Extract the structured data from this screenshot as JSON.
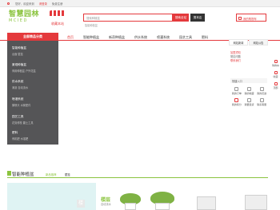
{
  "topbar": {
    "items": [
      "您好，欢迎来到",
      "请登录",
      "免费注册"
    ]
  },
  "header": {
    "logo_cn": "智慧园林",
    "logo_en": "MCIED",
    "badge_caption": "收藏本站",
    "search_placeholder": "搜索种植盆",
    "btn_search_site": "搜索全站",
    "btn_search_shop": "搜本店",
    "hot_words": "智能种植盆",
    "cart_label": "我的购物车"
  },
  "nav": {
    "category_header": "全部商品分类",
    "items": [
      "首页",
      "智能种植盆",
      "新奇种植盆",
      "供水系统",
      "喷灌系统",
      "园艺工具",
      "肥料"
    ]
  },
  "categories": [
    {
      "title": "智能种植盆",
      "sub": "台面  壁挂"
    },
    {
      "title": "景观种植盆",
      "sub": "商用种植盆  户外花盆"
    },
    {
      "title": "供水系统",
      "sub": "滴灌  自动浇水"
    },
    {
      "title": "喷灌系统",
      "sub": "微喷头  水管配件"
    },
    {
      "title": "园艺工具",
      "sub": "花剪修枝  翻土工具"
    },
    {
      "title": "肥料",
      "sub": "有机肥  水溶肥"
    }
  ],
  "user_panel": {
    "tabs": [
      "网站新闻",
      "网站公告"
    ],
    "links": [
      "加盟须知",
      "常见问题",
      "联系我们"
    ],
    "section_label": "快捷入口",
    "icons": [
      {
        "label": "我的订单",
        "icon": "order-icon"
      },
      {
        "label": "我的收藏",
        "icon": "heart-icon"
      },
      {
        "label": "我的足迹",
        "icon": "footprint-icon"
      },
      {
        "label": "我的积分",
        "icon": "points-icon"
      },
      {
        "label": "我要退货",
        "icon": "return-icon"
      },
      {
        "label": "联系客服",
        "icon": "service-icon"
      }
    ]
  },
  "side_tools": [
    {
      "label": "购物车",
      "icon": "cart-icon"
    },
    {
      "label": "收藏",
      "icon": "star-icon"
    },
    {
      "label": "顶部",
      "icon": "top-icon"
    }
  ],
  "floor": {
    "title": "智能种植盆",
    "tabs": [
      "新品推荐",
      "壁挂"
    ],
    "banner_char": "楼",
    "promo_title": "楼层",
    "promo_sub": "自动浇水"
  },
  "colors": {
    "accent": "#e4393c",
    "brand_green": "#8bc43f",
    "sidebar_bg": "#555557"
  }
}
